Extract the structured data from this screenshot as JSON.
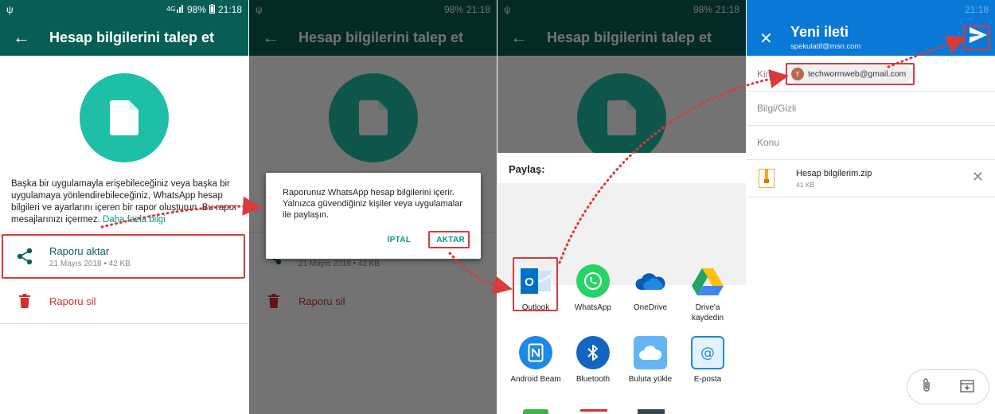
{
  "status": {
    "usb": "ψ",
    "battery": "98%",
    "time": "21:18",
    "network": "4G"
  },
  "screen": {
    "title": "Hesap bilgilerini talep et",
    "description": "Başka bir uygulamayla erişebileceğiniz veya başka bir uygulamaya yönlendirebileceğiniz, WhatsApp hesap bilgileri ve ayarlarını içeren bir rapor oluşturun. Bu rapor mesajlarınızı içermez.",
    "learn_more": "Daha fazla bilgi",
    "export": {
      "label": "Raporu aktar",
      "meta": "21 Mayıs 2018 • 42 KB"
    },
    "delete": {
      "label": "Raporu sil"
    }
  },
  "dialog": {
    "message": "Raporunuz WhatsApp hesap bilgilerini içerir. Yalnızca güvendiğiniz kişiler veya uygulamalar ile paylaşın.",
    "cancel": "İPTAL",
    "confirm": "AKTAR"
  },
  "share": {
    "title": "Paylaş:",
    "apps": [
      {
        "label": "Outlook",
        "icon": "outlook-icon",
        "color": "#0072c6"
      },
      {
        "label": "WhatsApp",
        "icon": "whatsapp-icon",
        "color": "#25d366"
      },
      {
        "label": "OneDrive",
        "icon": "onedrive-icon",
        "color": "#0a5bb5"
      },
      {
        "label": "Drive'a kaydedin",
        "icon": "google-drive-icon",
        "color": "#1fa463"
      },
      {
        "label": "Android Beam",
        "icon": "nfc-icon",
        "color": "#1e88e5"
      },
      {
        "label": "Bluetooth",
        "icon": "bluetooth-icon",
        "color": "#1565c0"
      },
      {
        "label": "Buluta yükle",
        "icon": "cloud-upload-icon",
        "color": "#64b5f6"
      },
      {
        "label": "E-posta",
        "icon": "email-icon",
        "color": "#1e88e5"
      }
    ]
  },
  "mail": {
    "title": "Yeni ileti",
    "from": "spekulatif@msn.com",
    "to_label": "Kime",
    "to_avatar": "T",
    "to_value": "techwormweb@gmail.com",
    "cc_label": "Bilgi/Gizli",
    "subject_label": "Konu",
    "attachment": {
      "name": "Hesap bilgilerim.zip",
      "size": "41 KB"
    }
  },
  "colors": {
    "whatsapp_dark": "#075e54",
    "whatsapp_accent": "#1fbea6",
    "outlook_blue": "#0a78d7",
    "highlight_red": "#d93a3a"
  }
}
